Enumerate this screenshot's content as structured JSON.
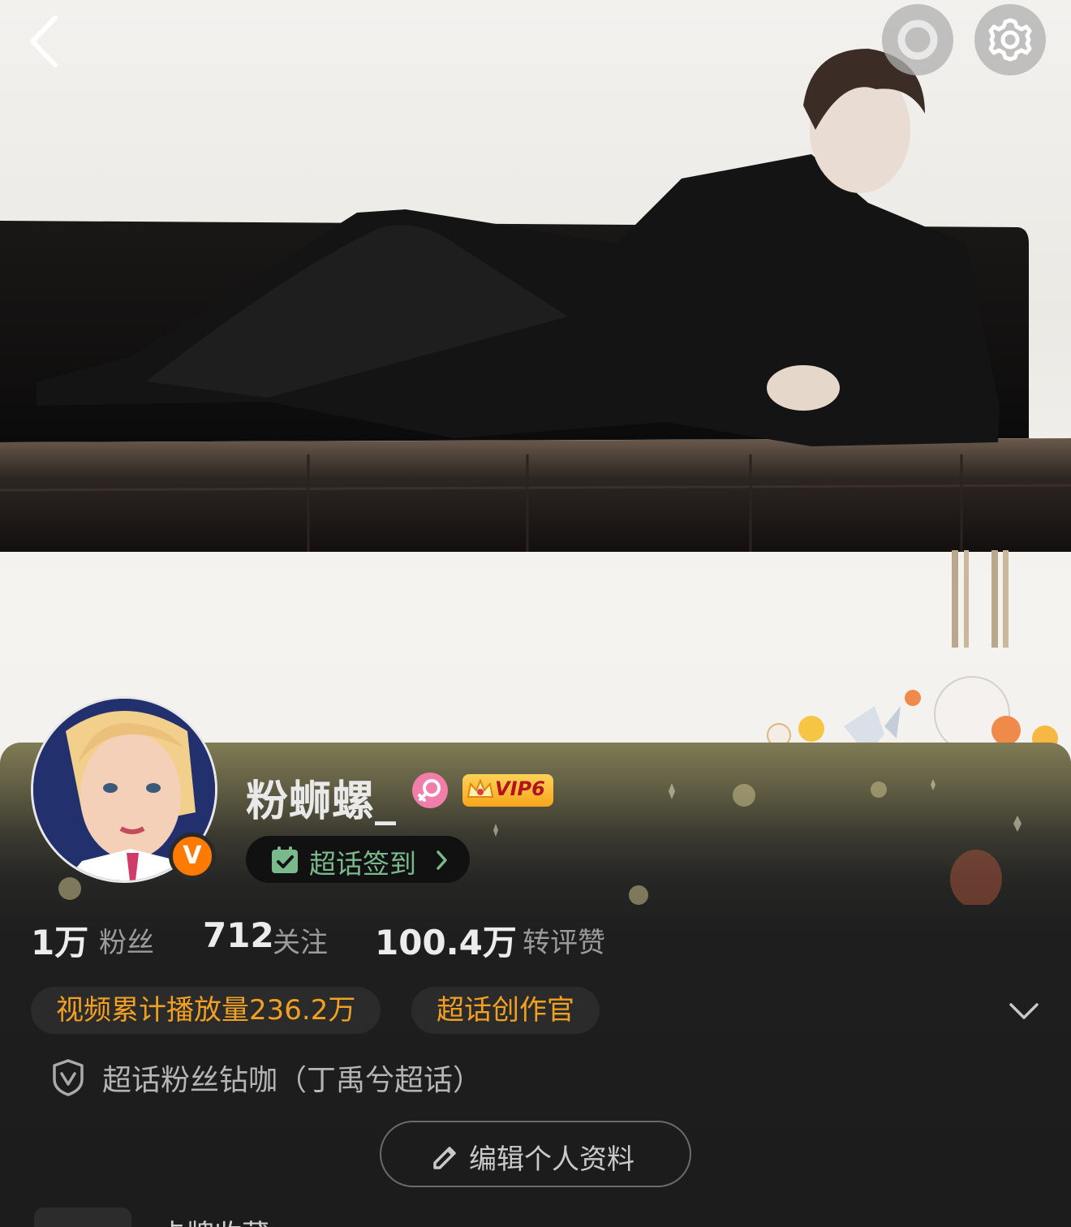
{
  "header": {
    "back_icon": "chevron-left-icon",
    "pulse_icon": "pulse-circle-icon",
    "settings_icon": "gear-icon"
  },
  "profile": {
    "username": "粉蛳螺_",
    "gender_icon": "female-icon",
    "vip_label": "VIP6",
    "verified_badge": "V",
    "checkin_label": "超话签到"
  },
  "stats": [
    {
      "value": "1万",
      "label": "粉丝"
    },
    {
      "value": "712",
      "label": "关注"
    },
    {
      "value": "100.4万",
      "label": "转评赞"
    }
  ],
  "tags": [
    {
      "label": "视频累计播放量236.2万"
    },
    {
      "label": "超话创作官"
    }
  ],
  "membership": {
    "text": "超话粉丝钻咖（丁禹兮超话）"
  },
  "actions": {
    "edit_label": "编辑个人资料"
  },
  "bottom": {
    "text": "卡牌收藏"
  },
  "colors": {
    "accent_orange": "#f2a022",
    "checkin_green": "#79b98b",
    "panel_bg": "#1c1c1c",
    "verified_orange": "#ff7a00",
    "gender_pink": "#f17ea8",
    "vip_gold": "#ffc53d"
  }
}
